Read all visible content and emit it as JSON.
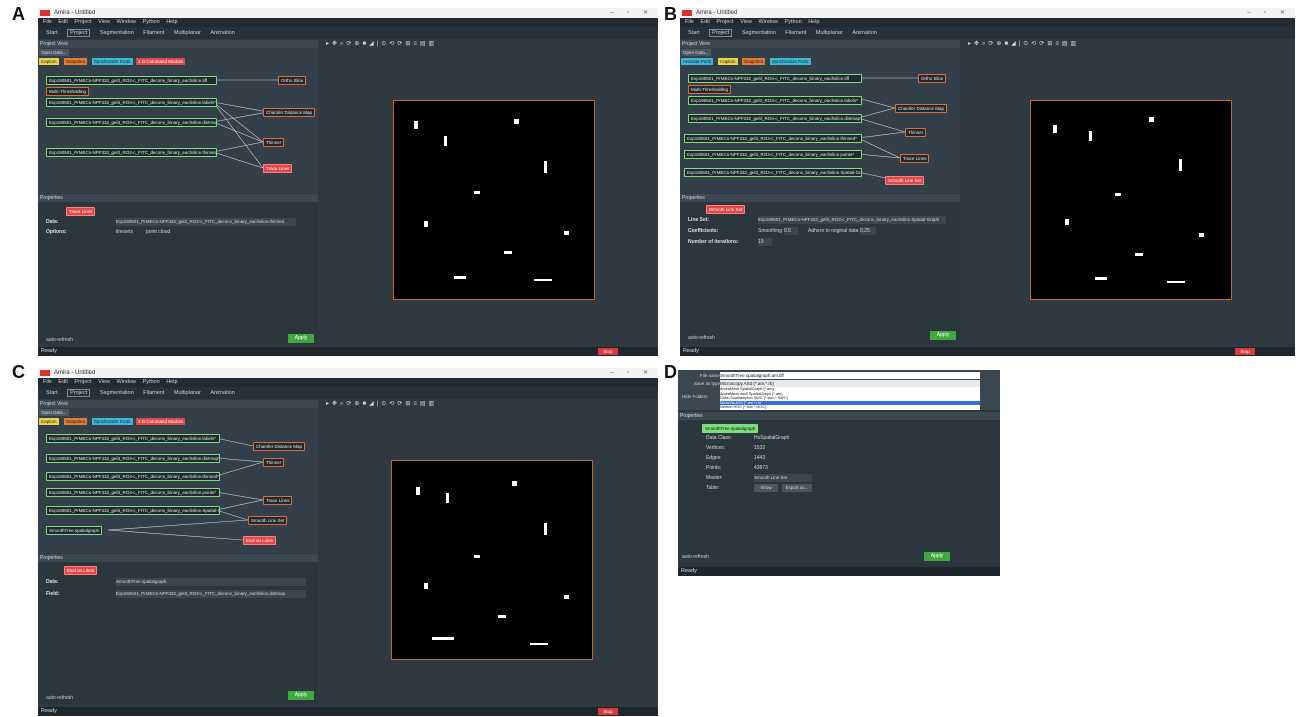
{
  "labels": {
    "a": "A",
    "b": "B",
    "c": "C",
    "d": "D"
  },
  "window": {
    "title": "Amira - Untitled",
    "menu": [
      "File",
      "Edit",
      "Project",
      "View",
      "Window",
      "Python",
      "Help"
    ],
    "tabs": [
      "Start",
      "Project",
      "Segmentation",
      "Filament",
      "Multiplanar",
      "Animation"
    ],
    "status": "Ready",
    "stop_label": "Stop",
    "apply_label": "Apply",
    "auto_refresh": "auto-refresh"
  },
  "project_view": {
    "title": "Project View",
    "open_data": "Open Data...",
    "quick_buttons_a": [
      "Caption",
      "Snapshot",
      "Synchronize Ports",
      "3 D Command Module"
    ],
    "quick_buttons_b": [
      "Animate Ports",
      "Caption",
      "Snapshot",
      "Synchronize Ports"
    ]
  },
  "panel_a": {
    "nodes": [
      {
        "text": "Exp190501_PrMECs-NPF332_gel3_RO3-c_FITC_deconv_binary_eachslice.tiff",
        "kind": "g"
      },
      {
        "text": "Ortho Slice",
        "kind": "o"
      },
      {
        "text": "Multi-Thresholding",
        "kind": "o"
      },
      {
        "text": "Exp190501_PrMECs-NPF332_gel3_RO3-c_FITC_deconv_binary_eachslice.labels*",
        "kind": "g"
      },
      {
        "text": "Chamfer Distance Map",
        "kind": "o"
      },
      {
        "text": "Exp190501_PrMECs-NPF332_gel3_RO3-c_FITC_deconv_binary_eachslice.distmap*",
        "kind": "g"
      },
      {
        "text": "Thinner",
        "kind": "o"
      },
      {
        "text": "Exp190501_PrMECs-NPF332_gel3_RO3-c_FITC_deconv_binary_eachslice.thinned*",
        "kind": "g"
      },
      {
        "text": "Trace Lines",
        "kind": "r"
      }
    ],
    "props_module": "Trace Lines",
    "data_label": "Data:",
    "data_value": "Exp190501_PrMECs-NPF332_gel3_RO3-c_FITC_deconv_binary_eachslice.thinned",
    "options_label": "Options:",
    "opt1": "linesets",
    "opt2": "point cloud"
  },
  "panel_b": {
    "nodes": [
      {
        "text": "Exp190501_PrMECs-NPF332_gel3_RO3-c_FITC_deconv_binary_eachslice.tiff",
        "kind": "g"
      },
      {
        "text": "Ortho Slice",
        "kind": "o"
      },
      {
        "text": "Multi-Thresholding",
        "kind": "o"
      },
      {
        "text": "Exp190501_PrMECs-NPF332_gel3_RO3-c_FITC_deconv_binary_eachslice.labels*",
        "kind": "g"
      },
      {
        "text": "Chamfer Distance Map",
        "kind": "o"
      },
      {
        "text": "Exp190501_PrMECs-NPF332_gel3_RO3-c_FITC_deconv_binary_eachslice.distmap*",
        "kind": "g"
      },
      {
        "text": "Thinner",
        "kind": "o"
      },
      {
        "text": "Exp190501_PrMECs-NPF332_gel3_RO3-c_FITC_deconv_binary_eachslice.thinned*",
        "kind": "g"
      },
      {
        "text": "Exp190501_PrMECs-NPF332_gel3_RO3-c_FITC_deconv_binary_eachslice.points*",
        "kind": "g"
      },
      {
        "text": "Trace Lines",
        "kind": "o"
      },
      {
        "text": "Exp190501_PrMECs-NPF332_gel3_RO3-c_FITC_deconv_binary_eachslice.Spatial-Graph*",
        "kind": "g"
      },
      {
        "text": "Smooth Line Set",
        "kind": "r"
      }
    ],
    "props_module": "Smooth Line Set",
    "lineset_label": "Line Set:",
    "lineset_value": "Exp190501_PrMECs-NPF332_gel3_RO3-c_FITC_deconv_binary_eachslice.Spatial-Graph",
    "coeff_label": "Coefficients:",
    "smoothing_label": "Smoothing",
    "smoothing_value": "0.5",
    "adhere_label": "Adhere to original data",
    "adhere_value": "0.25",
    "iter_label": "Number of iterations:",
    "iter_value": "10"
  },
  "panel_c": {
    "nodes": [
      {
        "text": "Exp190501_PrMECs-NPF332_gel3_RO3-c_FITC_deconv_binary_eachslice.labels*",
        "kind": "g"
      },
      {
        "text": "Chamfer Distance Map",
        "kind": "o"
      },
      {
        "text": "Exp190501_PrMECs-NPF332_gel3_RO3-c_FITC_deconv_binary_eachslice.distmap*",
        "kind": "g"
      },
      {
        "text": "Thinner",
        "kind": "o"
      },
      {
        "text": "Exp190501_PrMECs-NPF332_gel3_RO3-c_FITC_deconv_binary_eachslice.thinned*",
        "kind": "g"
      },
      {
        "text": "Exp190501_PrMECs-NPF332_gel3_RO3-c_FITC_deconv_binary_eachslice.points*",
        "kind": "g"
      },
      {
        "text": "Trace Lines",
        "kind": "o"
      },
      {
        "text": "Exp190501_PrMECs-NPF332_gel3_RO3-c_FITC_deconv_binary_eachslice.Spatial-Graph*",
        "kind": "g"
      },
      {
        "text": "Smooth Line Set",
        "kind": "o"
      },
      {
        "text": "SmoothTree.spatialgraph",
        "kind": "g"
      },
      {
        "text": "Eval on Lines",
        "kind": "r"
      }
    ],
    "props_module": "Eval on Lines",
    "data_label": "Data:",
    "data_value": "SmoothTree.spatialgraph",
    "field_label": "Field:",
    "field_value": "Exp190501_PrMECs-NPF332_gel3_RO3-c_FITC_deconv_binary_eachslice.distmap"
  },
  "panel_d": {
    "file_name_label": "File name:",
    "file_name_value": "SmoothTree.spatialgraph.am.tiff",
    "save_type_label": "Save as type:",
    "save_type_value": "Microscopy.AS3 (*.am,*.rb)",
    "hide_folders": "Hide Folders",
    "save_types": [
      "AmiraMesh SpatialGraph (*.am)",
      "AmiraMesh ascii SpatialGraph (*.am)",
      "Duke-Southampton SWC (*.swc,*.SWC)",
      "MicroVis.AS3 (*.am,*.rb)",
      "Neuron HOC (*.hoc,*.HOC)"
    ],
    "properties_title": "Properties",
    "object_name": "SmoothTree.spatialgraph",
    "fields": [
      {
        "label": "Data Class:",
        "value": "HxSpatialGraph"
      },
      {
        "label": "Vertices:",
        "value": "1532"
      },
      {
        "label": "Edges:",
        "value": "1443"
      },
      {
        "label": "Points:",
        "value": "43873"
      },
      {
        "label": "Master:",
        "value": "Smooth Line Set"
      },
      {
        "label": "Table:",
        "value": ""
      }
    ],
    "show_btn": "Show",
    "export_btn": "Export as...",
    "auto_refresh": "auto-refresh",
    "apply_label": "Apply",
    "status": "Ready"
  },
  "colors": {
    "panel_bg": "#2f3940",
    "node_green": "#7be07b",
    "node_red": "#e04848",
    "apply_green": "#3fa83f",
    "viewer_frame": "#c06a3a"
  }
}
